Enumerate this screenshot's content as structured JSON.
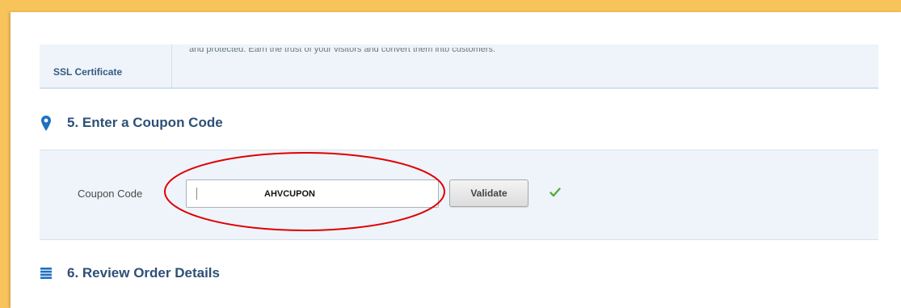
{
  "ssl": {
    "label": "SSL Certificate",
    "description": "and protected. Earn the trust of your visitors and convert them into customers."
  },
  "coupon_section": {
    "title": "5. Enter a Coupon Code",
    "icon": "map-pin-icon",
    "field_label": "Coupon Code",
    "field_value": "AHVCUPON",
    "validate_label": "Validate",
    "status_icon": "checkmark-icon"
  },
  "review_section": {
    "title": "6. Review Order Details",
    "icon": "list-icon"
  },
  "colors": {
    "background": "#f7c35a",
    "heading": "#2e5077",
    "accent_blue": "#1f6fc0",
    "success": "#5aab3a",
    "highlight": "#e00000"
  }
}
